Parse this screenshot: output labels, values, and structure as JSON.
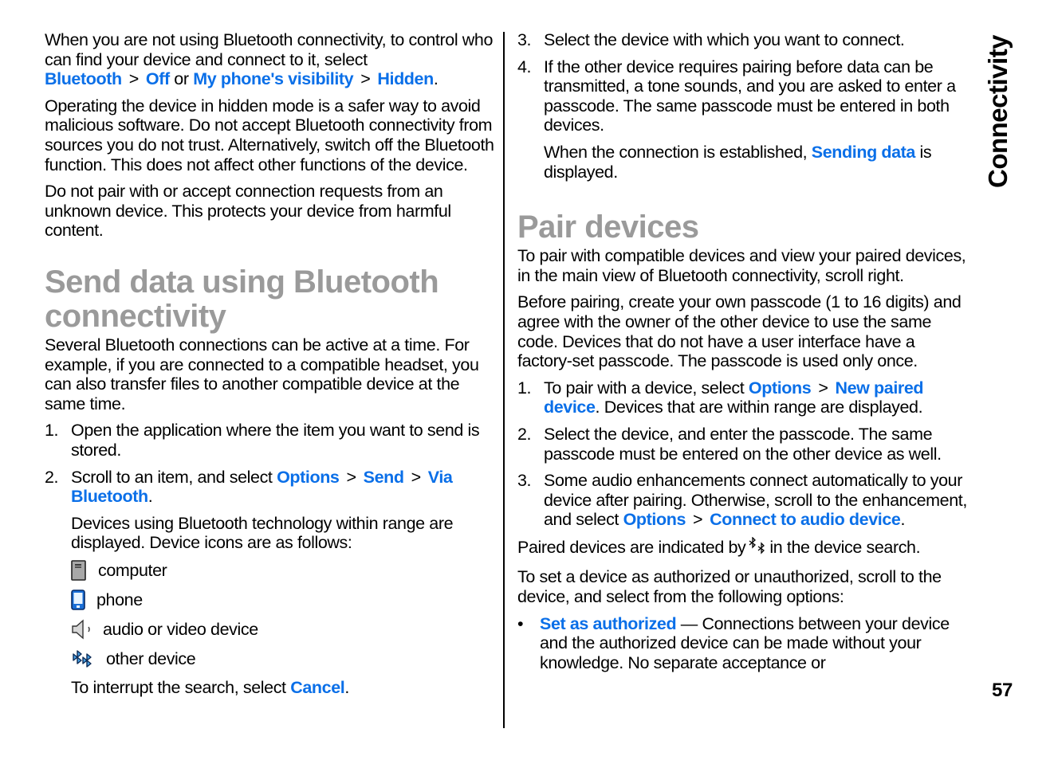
{
  "section_tab": "Connectivity",
  "page_number": "57",
  "colors": {
    "link": "#0a6fe8",
    "heading": "#9a9a9a",
    "text": "#000000"
  },
  "left": {
    "intro": {
      "text": "When you are not using Bluetooth connectivity, to control who can find your device and connect to it, select ",
      "link1": "Bluetooth",
      "sep": ">",
      "link2": "Off",
      "or": "or",
      "link3": "My phone's visibility",
      "link4": "Hidden",
      "end": "."
    },
    "para2": "Operating the device in hidden mode is a safer way to avoid malicious software. Do not accept Bluetooth connectivity from sources you do not trust. Alternatively, switch off the Bluetooth function. This does not affect other functions of the device.",
    "para3": "Do not pair with or accept connection requests from an unknown device. This protects your device from harmful content.",
    "heading": "Send data using Bluetooth connectivity",
    "para4": "Several Bluetooth connections can be active at a time. For example, if you are connected to a compatible headset, you can also transfer files to another compatible device at the same time.",
    "steps": [
      {
        "num": "1.",
        "text": "Open the application where the item you want to send is stored."
      },
      {
        "num": "2.",
        "text": "Scroll to an item, and select ",
        "link1": "Options",
        "link2": "Send",
        "link3": "Via Bluetooth",
        "end": "."
      }
    ],
    "devices_intro": "Devices using Bluetooth technology within range are displayed. Device icons are as follows:",
    "device_icons": [
      {
        "icon": "computer-icon",
        "label": "computer"
      },
      {
        "icon": "phone-icon",
        "label": "phone"
      },
      {
        "icon": "audio-video-device-icon",
        "label": "audio or video device"
      },
      {
        "icon": "other-device-bluetooth-icon",
        "label": "other device"
      }
    ],
    "cancel": {
      "text": "To interrupt the search, select ",
      "link": "Cancel",
      "end": "."
    }
  },
  "right": {
    "steps": [
      {
        "num": "3.",
        "text": "Select the device with which you want to connect."
      },
      {
        "num": "4.",
        "text": "If the other device requires pairing before data can be transmitted, a tone sounds, and you are asked to enter a passcode. The same passcode must be entered in both devices."
      }
    ],
    "established": {
      "text": "When the connection is established, ",
      "link": "Sending data",
      "end": " is displayed."
    },
    "heading": "Pair devices",
    "para1": "To pair with compatible devices and view your paired devices, in the main view of Bluetooth connectivity, scroll right.",
    "para2": "Before pairing, create your own passcode (1 to 16 digits) and agree with the owner of the other device to use the same code. Devices that do not have a user interface have a factory-set passcode. The passcode is used only once.",
    "pair_steps": [
      {
        "num": "1.",
        "text": "To pair with a device, select ",
        "link1": "Options",
        "link2": "New paired device",
        "end": ". Devices that are within range are displayed."
      },
      {
        "num": "2.",
        "text": "Select the device, and enter the passcode. The same passcode must be entered on the other device as well."
      },
      {
        "num": "3.",
        "text": "Some audio enhancements connect automatically to your device after pairing. Otherwise, scroll to the enhancement, and select ",
        "link1": "Options",
        "link2": "Connect to audio device",
        "end": "."
      }
    ],
    "paired_indicator": {
      "before": "Paired devices are indicated by",
      "after": "in the device search."
    },
    "para3": "To set a device as authorized or unauthorized, scroll to the device, and select from the following options:",
    "options": [
      {
        "bullet": "•",
        "link": "Set as authorized",
        "text": " — Connections between your device and the authorized device can be made without your knowledge. No separate acceptance or"
      }
    ]
  }
}
